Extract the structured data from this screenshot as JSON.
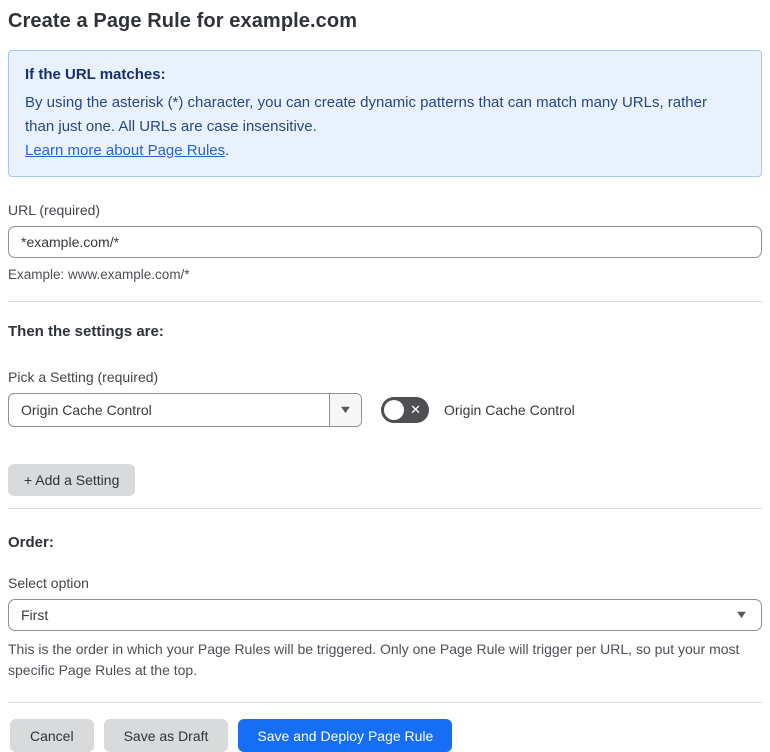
{
  "page": {
    "title": "Create a Page Rule for example.com"
  },
  "info_box": {
    "heading": "If the URL matches:",
    "body": "By using the asterisk (*) character, you can create dynamic patterns that can match many URLs, rather than just one. All URLs are case insensitive.",
    "link_label": "Learn more about Page Rules",
    "link_suffix": "."
  },
  "url_field": {
    "label": "URL (required)",
    "value": "*example.com/*",
    "example": "Example: www.example.com/*"
  },
  "settings": {
    "heading": "Then the settings are:",
    "picker_label": "Pick a Setting (required)",
    "selected_setting": "Origin Cache Control",
    "toggle_label": "Origin Cache Control",
    "toggle_state": "off",
    "add_button_label": "+ Add a Setting"
  },
  "order": {
    "heading": "Order:",
    "label": "Select option",
    "selected_option": "First",
    "help": "This is the order in which your Page Rules will be triggered. Only one Page Rule will trigger per URL, so put your most specific Page Rules at the top."
  },
  "footer": {
    "cancel_label": "Cancel",
    "save_draft_label": "Save as Draft",
    "save_deploy_label": "Save and Deploy Page Rule"
  },
  "icons": {
    "caret_down": "▼",
    "close": "✕"
  },
  "colors": {
    "accent_blue": "#166ef4",
    "info_bg": "#e9f2fc",
    "info_border": "#a8c7ec",
    "info_heading_text": "#16316d",
    "info_body_text": "#26477f",
    "link_blue": "#2c63cd",
    "toggle_off_bg": "#4d4f52",
    "button_gray": "#d9dadb"
  }
}
